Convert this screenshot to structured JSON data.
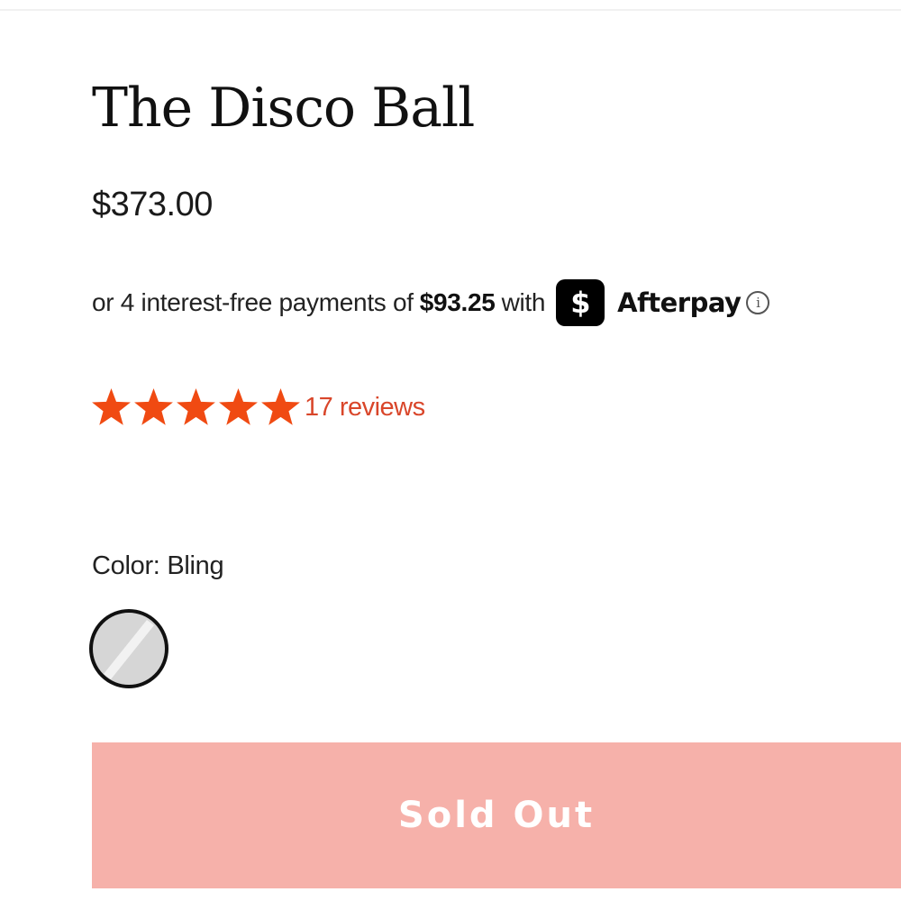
{
  "product": {
    "title": "The Disco Ball",
    "price": "$373.00"
  },
  "afterpay": {
    "prefix": "or 4 interest-free payments of",
    "amount": "$93.25",
    "suffix": "with",
    "badge_glyph": "$",
    "brand": "Afterpay",
    "badge_icon": "afterpay-logo-icon",
    "info_icon": "info-icon",
    "info_glyph": "i"
  },
  "rating": {
    "stars": 5,
    "max_stars": 5,
    "reviews_label": "17 reviews",
    "star_color": "#f04a12"
  },
  "color": {
    "label": "Color: Bling",
    "selected_swatch": "bling-swatch"
  },
  "cta": {
    "label": "Sold Out",
    "background": "#f6b1aa"
  }
}
